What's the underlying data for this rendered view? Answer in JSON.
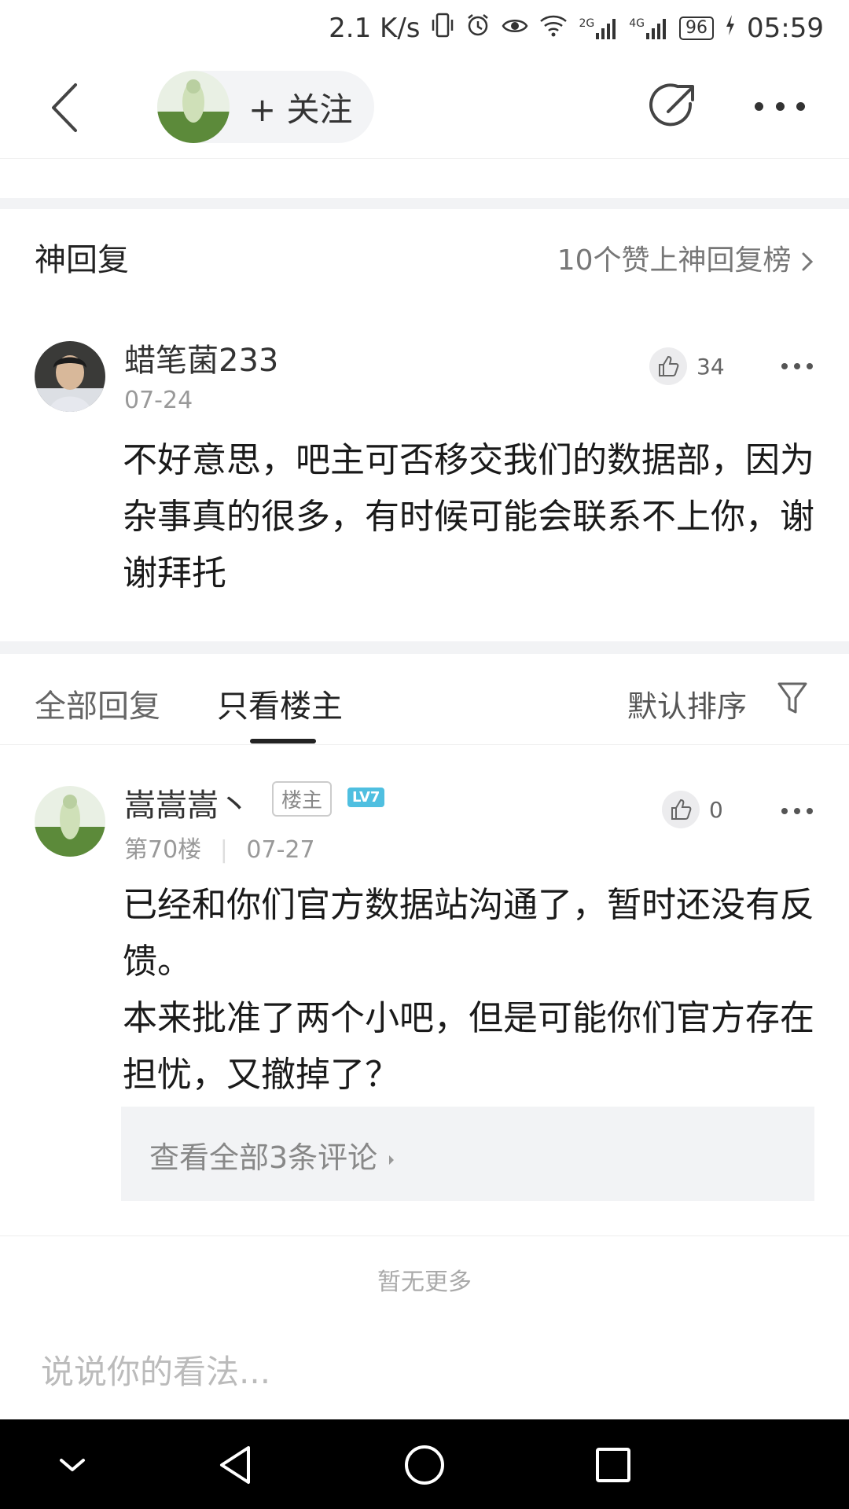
{
  "status_bar": {
    "net_speed": "2.1 K/s",
    "net_2g": "2G",
    "net_4g": "4G",
    "battery": "96",
    "time": "05:59"
  },
  "nav": {
    "follow_label": "+ 关注"
  },
  "god_reply": {
    "title": "神回复",
    "link": "10个赞上神回复榜"
  },
  "featured_post": {
    "username": "蜡笔菌233",
    "date": "07-24",
    "likes": "34",
    "text": "不好意思，吧主可否移交我们的数据部，因为杂事真的很多，有时候可能会联系不上你，谢谢拜托"
  },
  "tabs": {
    "all": "全部回复",
    "lz_only": "只看楼主",
    "sort": "默认排序"
  },
  "reply_post": {
    "username": "嵩嵩嵩丶",
    "badge": "楼主",
    "level": "LV7",
    "floor": "第70楼",
    "date": "07-27",
    "likes": "0",
    "text_line1": "已经和你们官方数据站沟通了，暂时还没有反馈。",
    "text_line2": "本来批准了两个小吧，但是可能你们官方存在担忧，又撤掉了？",
    "comments_link": "查看全部3条评论"
  },
  "footer": {
    "no_more": "暂无更多",
    "input_placeholder": "说说你的看法..."
  },
  "colors": {
    "background": "#ffffff",
    "band": "#f2f3f5",
    "level_badge": "#4fbfe0",
    "system_nav": "#000000"
  }
}
